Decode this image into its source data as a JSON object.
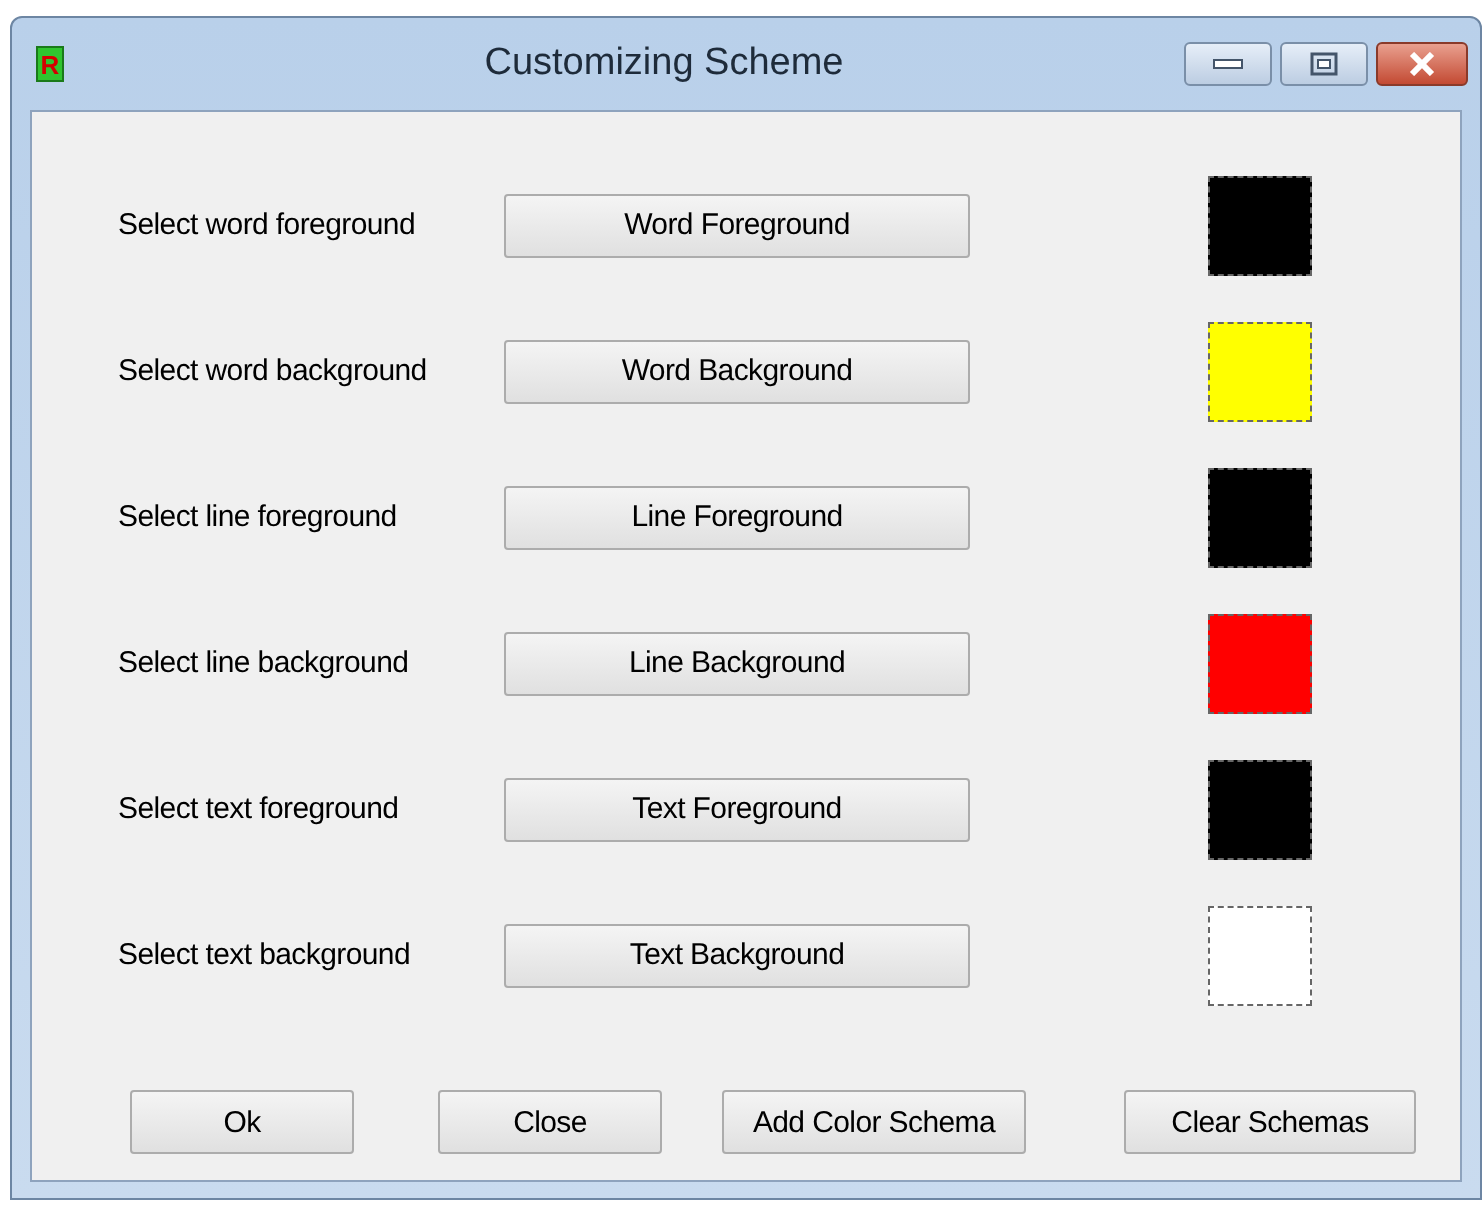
{
  "window": {
    "icon_letter": "R",
    "title": "Customizing Scheme"
  },
  "rows": [
    {
      "label": "Select word foreground",
      "button": "Word Foreground",
      "color": "#000000"
    },
    {
      "label": "Select word background",
      "button": "Word Background",
      "color": "#ffff00"
    },
    {
      "label": "Select line foreground",
      "button": "Line Foreground",
      "color": "#000000"
    },
    {
      "label": "Select line background",
      "button": "Line Background",
      "color": "#ff0000"
    },
    {
      "label": "Select text foreground",
      "button": "Text Foreground",
      "color": "#000000"
    },
    {
      "label": "Select text background",
      "button": "Text Background",
      "color": "#ffffff"
    }
  ],
  "buttons": [
    "Ok",
    "Close",
    "Add Color Schema",
    "Clear Schemas"
  ]
}
